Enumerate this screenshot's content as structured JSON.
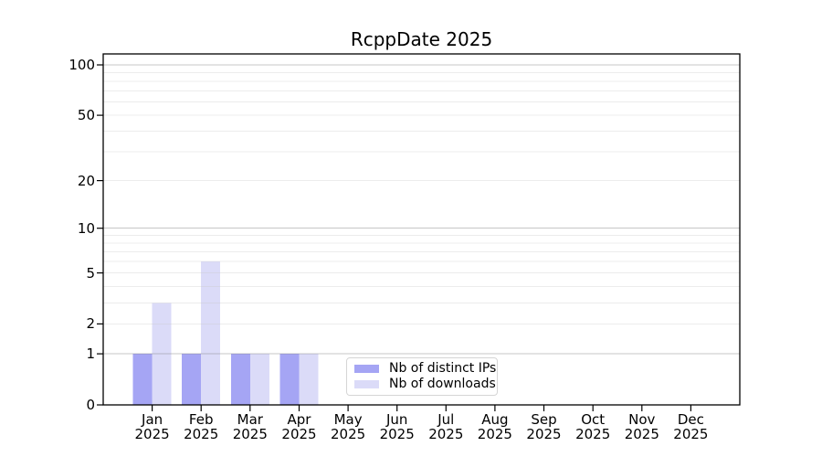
{
  "figure": {
    "title": "RcppDate 2025"
  },
  "colors": {
    "bar_distinct_ips": "#a5a5f4",
    "bar_downloads": "#dbdbf8",
    "grid_decade": "rgba(130,130,130,0.45)",
    "grid_minor": "rgba(200,200,200,0.35)",
    "axis": "#000000",
    "legend_border": "#d5d5d5",
    "text": "#000000"
  },
  "chart_data": {
    "type": "bar",
    "title": "RcppDate 2025",
    "categories": [
      "Jan 2025",
      "Feb 2025",
      "Mar 2025",
      "Apr 2025",
      "May 2025",
      "Jun 2025",
      "Jul 2025",
      "Aug 2025",
      "Sep 2025",
      "Oct 2025",
      "Nov 2025",
      "Dec 2025"
    ],
    "series": [
      {
        "name": "Nb of distinct IPs",
        "values": [
          1,
          1,
          1,
          1,
          0,
          0,
          0,
          0,
          0,
          0,
          0,
          0
        ]
      },
      {
        "name": "Nb of downloads",
        "values": [
          3,
          6,
          1,
          1,
          0,
          0,
          0,
          0,
          0,
          0,
          0,
          0
        ]
      }
    ],
    "xlabel": "",
    "ylabel": "",
    "y_scale": "log1p",
    "y_ticks": [
      0,
      1,
      2,
      5,
      10,
      20,
      50,
      100
    ],
    "y_axis_max": 117,
    "grid": "horizontal",
    "grid_decade_lines": [
      1,
      10,
      100
    ],
    "grid_minor_lines": [
      2,
      3,
      4,
      5,
      6,
      7,
      8,
      9,
      20,
      30,
      40,
      50,
      60,
      70,
      80,
      90
    ],
    "legend_position": "inside-bottom-center"
  }
}
